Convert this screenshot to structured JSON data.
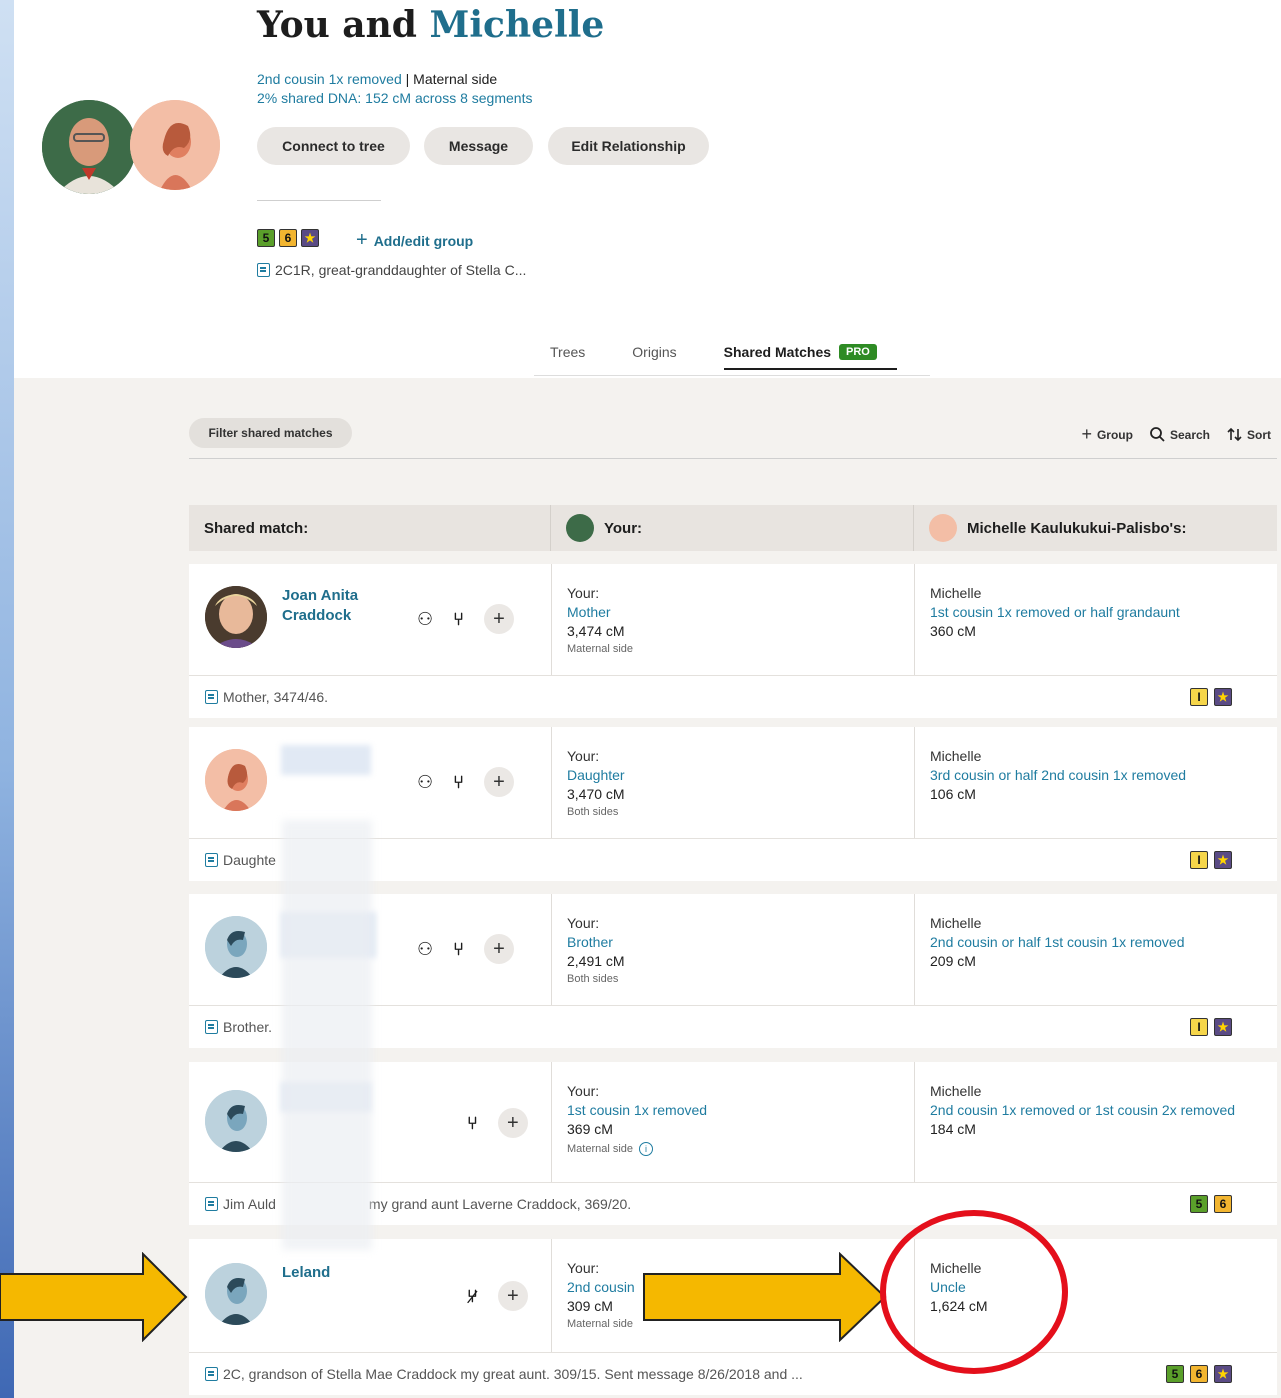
{
  "header": {
    "title_prefix": "You and",
    "title_name": "Michelle",
    "relationship": "2nd cousin 1x removed",
    "relationship_side": " | Maternal side",
    "shared_dna": "2% shared DNA: 152 cM across 8 segments",
    "buttons": [
      "Connect to tree",
      "Message",
      "Edit Relationship"
    ],
    "group_badges": [
      "5",
      "6",
      "★"
    ],
    "add_group": "Add/edit group",
    "note": "2C1R, great-granddaughter of Stella C..."
  },
  "tabs": [
    {
      "label": "Trees",
      "active": false
    },
    {
      "label": "Origins",
      "active": false
    },
    {
      "label": "Shared Matches",
      "active": true,
      "tag": "PRO"
    }
  ],
  "toolbar": {
    "filter": "Filter shared matches",
    "group": "Group",
    "search": "Search",
    "sort": "Sort"
  },
  "table_header": {
    "shared_match": "Shared match:",
    "your": "Your:",
    "theirs": "Michelle Kaulukukui-Palisbo's:"
  },
  "matches": [
    {
      "name": "Joan Anita Craddock",
      "your_label": "Your:",
      "your_rel": "Mother",
      "your_cm": "3,474 cM",
      "your_side": "Maternal side",
      "their_label": "Michelle",
      "their_rel": "1st cousin 1x removed or half grandaunt",
      "their_cm": "360 cM",
      "note": "Mother, 3474/46.",
      "badges": [
        "I",
        "★"
      ]
    },
    {
      "name": "",
      "your_label": "Your:",
      "your_rel": "Daughter",
      "your_cm": "3,470 cM",
      "your_side": "Both sides",
      "their_label": "Michelle",
      "their_rel": "3rd cousin or half 2nd cousin 1x removed",
      "their_cm": "106 cM",
      "note": "Daughte",
      "badges": [
        "I",
        "★"
      ]
    },
    {
      "name": "",
      "your_label": "Your:",
      "your_rel": "Brother",
      "your_cm": "2,491 cM",
      "your_side": "Both sides",
      "their_label": "Michelle",
      "their_rel": "2nd cousin or half 1st cousin 1x removed",
      "their_cm": "209 cM",
      "note": "Brother.",
      "badges": [
        "I",
        "★"
      ]
    },
    {
      "name": "",
      "your_label": "Your:",
      "your_rel": "1st cousin 1x removed",
      "your_cm": "369 cM",
      "your_side": "Maternal side",
      "their_label": "Michelle",
      "their_rel": "2nd cousin 1x removed or 1st cousin 2x removed",
      "their_cm": "184 cM",
      "note": "Jim Auld",
      "note_tail": "my grand aunt Laverne Craddock, 369/20.",
      "badges": [
        "5",
        "6"
      ]
    },
    {
      "name": "Leland",
      "your_label": "Your:",
      "your_rel": "2nd cousin",
      "your_cm": "309 cM",
      "your_side": "Maternal side",
      "their_label": "Michelle",
      "their_rel": "Uncle",
      "their_cm": "1,624 cM",
      "note": "2C, grandson of Stella Mae Craddock my great aunt. 309/15. Sent message 8/26/2018 and ...",
      "badges": [
        "5",
        "6",
        "★"
      ]
    }
  ],
  "colors": {
    "accent": "#1f6e8c",
    "link": "#1f7ca0",
    "arrow": "#f5b800",
    "circle": "#e40f1b",
    "pro": "#2e8b24"
  }
}
